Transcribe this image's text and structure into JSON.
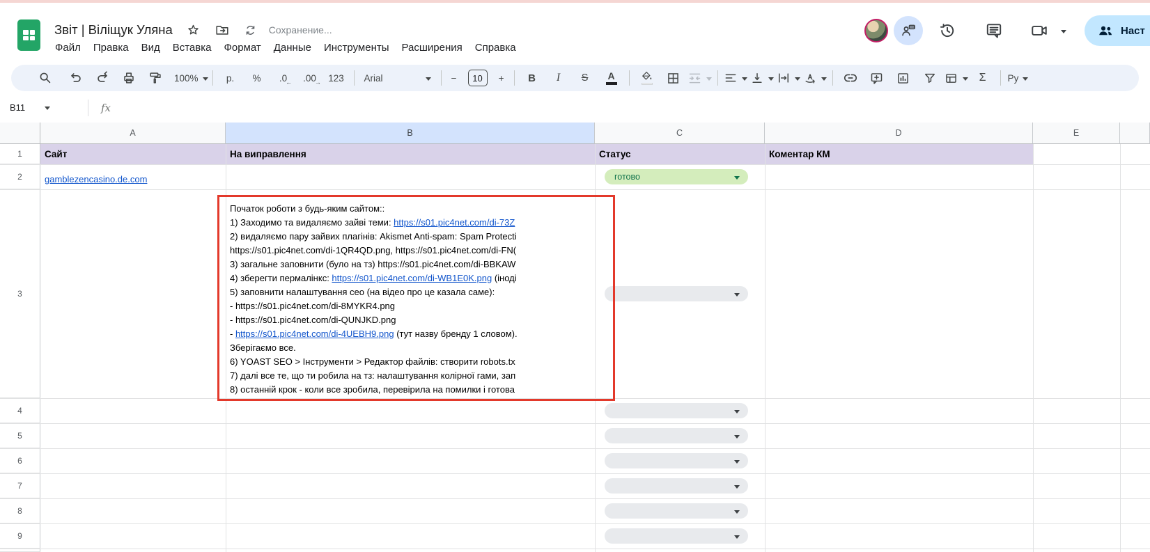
{
  "header": {
    "doc_title": "Звіт | Віліщук Уляна",
    "saving_status": "Сохранение...",
    "menu_items": [
      "Файл",
      "Правка",
      "Вид",
      "Вставка",
      "Формат",
      "Данные",
      "Инструменты",
      "Расширения",
      "Справка"
    ],
    "share_button_label": "Наст",
    "icons": [
      "sheets-logo",
      "star-icon",
      "move-folder-icon",
      "sync-icon",
      "avatar",
      "contacts-chat-icon",
      "history-icon",
      "comments-icon",
      "video-call-icon",
      "share-people-icon"
    ]
  },
  "toolbar": {
    "zoom_value": "100%",
    "currency_format_label": "р.",
    "percent_format_label": "%",
    "decrease_decimals_label": ".0",
    "decrease_decimals_arrow": "←",
    "increase_decimals_label": ".00",
    "increase_decimals_arrow": "→",
    "more_formats_label": "123",
    "font_name": "Arial",
    "minus_label": "−",
    "font_size": "10",
    "plus_label": "+",
    "bold_label": "B",
    "italic_label": "I",
    "strikethrough_label": "S",
    "text_color_label": "A",
    "sum_label": "Σ",
    "input_tools_label": "Ру",
    "text_color_bar": "#202124",
    "fill_color_bar": "#ffffff"
  },
  "formula_bar": {
    "name_box_value": "B11",
    "fx_label": "fx"
  },
  "sheet": {
    "column_letters": [
      "A",
      "B",
      "C",
      "D",
      "E",
      ""
    ],
    "selected_column_index": 1,
    "row_numbers": [
      "1",
      "2",
      "3",
      "4",
      "5",
      "6",
      "7",
      "8",
      "9"
    ],
    "header_row": {
      "a": "Сайт",
      "b": "На виправлення",
      "c": "Статус",
      "d": "Коментар КМ"
    },
    "row2": {
      "site_link": "gamblezencasino.de.com",
      "status_value": "готово"
    },
    "empty_status_rows": [
      3,
      4,
      5,
      6,
      7,
      8,
      9
    ],
    "cell_b3_lines": [
      [
        {
          "t": "Початок роботи з будь-яким сайтом::"
        }
      ],
      [
        {
          "t": "1) Заходимо та видаляємо зайві теми: "
        },
        {
          "t": "https://s01.pic4net.com/di-73Z",
          "link": true
        }
      ],
      [
        {
          "t": "2) видаляємо пару зайвих плагінів: Akismet Anti-spam: Spam Protecti"
        }
      ],
      [
        {
          "t": "https://s01.pic4net.com/di-1QR4QD.png, https://s01.pic4net.com/di-FN("
        }
      ],
      [
        {
          "t": "3) загальне заповнити (було на тз) https://s01.pic4net.com/di-BBKAW"
        }
      ],
      [
        {
          "t": "4) зберегти пермалінкс: "
        },
        {
          "t": "https://s01.pic4net.com/di-WB1E0K.png",
          "link": true
        },
        {
          "t": " (іноді"
        }
      ],
      [
        {
          "t": "5) заповнити налаштування сео (на відео про це казала саме):"
        }
      ],
      [
        {
          "t": "- https://s01.pic4net.com/di-8MYKR4.png"
        }
      ],
      [
        {
          "t": "- https://s01.pic4net.com/di-QUNJKD.png"
        }
      ],
      [
        {
          "t": "- "
        },
        {
          "t": "https://s01.pic4net.com/di-4UEBH9.png",
          "link": true
        },
        {
          "t": " (тут назву бренду 1 словом)."
        }
      ],
      [
        {
          "t": "Зберігаємо все."
        }
      ],
      [
        {
          "t": "6) YOAST SEO > Інструменти > Редактор файлів: створити robots.tx"
        }
      ],
      [
        {
          "t": "7) далі все те, що ти робила на тз: налаштування колірної гами, зап"
        }
      ],
      [
        {
          "t": "8) останній крок - коли все зробила, перевірила на помилки і готова"
        }
      ]
    ],
    "colors": {
      "header_fill": "#d9d2e9",
      "selected_header": "#d3e3fd",
      "status_done_bg": "#d4edbc",
      "status_done_text": "#11734b",
      "empty_chip_bg": "#e8eaed",
      "link": "#1155cc",
      "annotation_box": "#e3392b"
    }
  }
}
